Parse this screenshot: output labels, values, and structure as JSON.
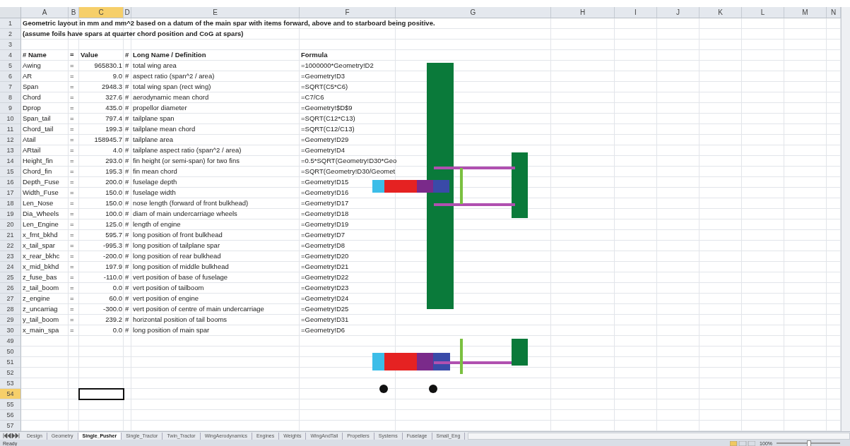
{
  "columns": [
    {
      "label": "A",
      "selected": false
    },
    {
      "label": "B",
      "selected": false
    },
    {
      "label": "C",
      "selected": true
    },
    {
      "label": "D",
      "selected": false
    },
    {
      "label": "E",
      "selected": false
    },
    {
      "label": "F",
      "selected": false
    },
    {
      "label": "G",
      "selected": false
    },
    {
      "label": "H",
      "selected": false
    },
    {
      "label": "I",
      "selected": false
    },
    {
      "label": "J",
      "selected": false
    },
    {
      "label": "K",
      "selected": false
    },
    {
      "label": "L",
      "selected": false
    },
    {
      "label": "M",
      "selected": false
    },
    {
      "label": "N",
      "selected": false
    }
  ],
  "rows": [
    {
      "number": "1",
      "selected": false,
      "kind": "note",
      "text": "Geometric layout in mm and mm^2 based on a datum of the main spar with items forward, above and to starboard being positive."
    },
    {
      "number": "2",
      "selected": false,
      "kind": "note",
      "text": "(assume foils have spars at quarter chord position and CoG at spars)"
    },
    {
      "number": "3",
      "selected": false,
      "kind": "blank"
    },
    {
      "number": "4",
      "selected": false,
      "kind": "header",
      "name": "# Name",
      "eq": "=",
      "value": "Value",
      "hash": "#",
      "definition": "Long Name / Definition",
      "formula": "Formula"
    },
    {
      "number": "5",
      "selected": false,
      "kind": "data",
      "name": "Awing",
      "eq": "=",
      "value": "965830.1",
      "hash": "#",
      "definition": "total wing area",
      "formula": "=1000000*Geometry!D2"
    },
    {
      "number": "6",
      "selected": false,
      "kind": "data",
      "name": "AR",
      "eq": "=",
      "value": "9.0",
      "hash": "#",
      "definition": "aspect  ratio (span^2 / area)",
      "formula": "=Geometry!D3"
    },
    {
      "number": "7",
      "selected": false,
      "kind": "data",
      "name": "Span",
      "eq": "=",
      "value": "2948.3",
      "hash": "#",
      "definition": "total wing span (rect wing)",
      "formula": "=SQRT(C5*C6)"
    },
    {
      "number": "8",
      "selected": false,
      "kind": "data",
      "name": "Chord",
      "eq": "=",
      "value": "327.6",
      "hash": "#",
      "definition": "aerodynamic mean chord",
      "formula": "=C7/C6"
    },
    {
      "number": "9",
      "selected": false,
      "kind": "data",
      "name": "Dprop",
      "eq": "=",
      "value": "435.0",
      "hash": "#",
      "definition": "propellor diameter",
      "formula": "=Geometry!$D$9"
    },
    {
      "number": "10",
      "selected": false,
      "kind": "data",
      "name": "Span_tail",
      "eq": "=",
      "value": "797.4",
      "hash": "#",
      "definition": "tailplane span",
      "formula": "=SQRT(C12*C13)"
    },
    {
      "number": "11",
      "selected": false,
      "kind": "data",
      "name": "Chord_tail",
      "eq": "=",
      "value": "199.3",
      "hash": "#",
      "definition": "tailplane mean chord",
      "formula": "=SQRT(C12/C13)"
    },
    {
      "number": "12",
      "selected": false,
      "kind": "data",
      "name": "Atail",
      "eq": "=",
      "value": "158945.7",
      "hash": "#",
      "definition": "tailplane area",
      "formula": "=Geometry!D29"
    },
    {
      "number": "13",
      "selected": false,
      "kind": "data",
      "name": "ARtail",
      "eq": "=",
      "value": "4.0",
      "hash": "#",
      "definition": "tailplane aspect ratio (span^2 / area)",
      "formula": "=Geometry!D4"
    },
    {
      "number": "14",
      "selected": false,
      "kind": "data",
      "name": "Height_fin",
      "eq": "=",
      "value": "293.0",
      "hash": "#",
      "definition": "fin height (or semi-span) for two fins",
      "formula": "=0.5*SQRT(Geometry!D30*Geo"
    },
    {
      "number": "15",
      "selected": false,
      "kind": "data",
      "name": "Chord_fin",
      "eq": "=",
      "value": "195.3",
      "hash": "#",
      "definition": "fin mean chord",
      "formula": "=SQRT(Geometry!D30/Geomet"
    },
    {
      "number": "16",
      "selected": false,
      "kind": "data",
      "name": "Depth_Fuse",
      "eq": "=",
      "value": "200.0",
      "hash": "#",
      "definition": "fuselage depth",
      "formula": "=Geometry!D15"
    },
    {
      "number": "17",
      "selected": false,
      "kind": "data",
      "name": "Width_Fuse",
      "eq": "=",
      "value": "150.0",
      "hash": "#",
      "definition": "fuselage width",
      "formula": "=Geometry!D16"
    },
    {
      "number": "18",
      "selected": false,
      "kind": "data",
      "name": "Len_Nose",
      "eq": "=",
      "value": "150.0",
      "hash": "#",
      "definition": "nose length (forward of front bulkhead)",
      "formula": "=Geometry!D17"
    },
    {
      "number": "19",
      "selected": false,
      "kind": "data",
      "name": "Dia_Wheels",
      "eq": "=",
      "value": "100.0",
      "hash": "#",
      "definition": "diam of main undercarriage wheels",
      "formula": "=Geometry!D18"
    },
    {
      "number": "20",
      "selected": false,
      "kind": "data",
      "name": "Len_Engine",
      "eq": "=",
      "value": "125.0",
      "hash": "#",
      "definition": "length of engine",
      "formula": "=Geometry!D19"
    },
    {
      "number": "21",
      "selected": false,
      "kind": "data",
      "name": "x_frnt_bkhd",
      "eq": "=",
      "value": "595.7",
      "hash": "#",
      "definition": "long position of front bulkhead",
      "formula": "=Geometry!D7"
    },
    {
      "number": "22",
      "selected": false,
      "kind": "data",
      "name": "x_tail_spar",
      "eq": "=",
      "value": "-995.3",
      "hash": "#",
      "definition": "long position of tailplane spar",
      "formula": "=Geometry!D8"
    },
    {
      "number": "23",
      "selected": false,
      "kind": "data",
      "name": "x_rear_bkhc",
      "eq": "=",
      "value": "-200.0",
      "hash": "#",
      "definition": "long position of rear bulkhead",
      "formula": "=Geometry!D20"
    },
    {
      "number": "24",
      "selected": false,
      "kind": "data",
      "name": "x_mid_bkhd",
      "eq": "=",
      "value": "197.9",
      "hash": "#",
      "definition": "long position of middle bulkhead",
      "formula": "=Geometry!D21"
    },
    {
      "number": "25",
      "selected": false,
      "kind": "data",
      "name": "z_fuse_bas",
      "eq": "=",
      "value": "-110.0",
      "hash": "#",
      "definition": "vert position of base of fuselage",
      "formula": "=Geometry!D22"
    },
    {
      "number": "26",
      "selected": false,
      "kind": "data",
      "name": "z_tail_boom",
      "eq": "=",
      "value": "0.0",
      "hash": "#",
      "definition": "vert position of tailboom",
      "formula": "=Geometry!D23"
    },
    {
      "number": "27",
      "selected": false,
      "kind": "data",
      "name": "z_engine",
      "eq": "=",
      "value": "60.0",
      "hash": "#",
      "definition": "vert position of engine",
      "formula": "=Geometry!D24"
    },
    {
      "number": "28",
      "selected": false,
      "kind": "data",
      "name": "z_uncarriag",
      "eq": "=",
      "value": "-300.0",
      "hash": "#",
      "definition": "vert position of centre of main undercarriage",
      "formula": "=Geometry!D25"
    },
    {
      "number": "29",
      "selected": false,
      "kind": "data",
      "name": "y_tail_boom",
      "eq": "=",
      "value": "239.2",
      "hash": "#",
      "definition": "horizontal position of tail booms",
      "formula": "=Geometry!D31"
    },
    {
      "number": "30",
      "selected": false,
      "kind": "data",
      "name": "x_main_spa",
      "eq": "=",
      "value": "0.0",
      "hash": "#",
      "definition": "long position of main spar",
      "formula": "=Geometry!D6"
    },
    {
      "number": "49",
      "selected": false,
      "kind": "blank"
    },
    {
      "number": "50",
      "selected": false,
      "kind": "blank"
    },
    {
      "number": "51",
      "selected": false,
      "kind": "blank"
    },
    {
      "number": "52",
      "selected": false,
      "kind": "blank"
    },
    {
      "number": "53",
      "selected": false,
      "kind": "blank"
    },
    {
      "number": "54",
      "selected": true,
      "kind": "blank"
    },
    {
      "number": "55",
      "selected": false,
      "kind": "blank"
    },
    {
      "number": "56",
      "selected": false,
      "kind": "blank"
    },
    {
      "number": "57",
      "selected": false,
      "kind": "blank"
    }
  ],
  "sheet_tabs": [
    {
      "label": "Design",
      "selected": false
    },
    {
      "label": "Geometry",
      "selected": false
    },
    {
      "label": "Single_Pusher",
      "selected": true
    },
    {
      "label": "Single_Tractor",
      "selected": false
    },
    {
      "label": "Twin_Tractor",
      "selected": false
    },
    {
      "label": "WingAerodynamics",
      "selected": false
    },
    {
      "label": "Engines",
      "selected": false
    },
    {
      "label": "Weights",
      "selected": false
    },
    {
      "label": "WingAndTail",
      "selected": false
    },
    {
      "label": "Propellers",
      "selected": false
    },
    {
      "label": "Systems",
      "selected": false
    },
    {
      "label": "Fuselage",
      "selected": false
    },
    {
      "label": "Small_Eng",
      "selected": false
    }
  ],
  "status_bar": {
    "status": "Ready",
    "zoom": "100%",
    "level": 0.5
  }
}
